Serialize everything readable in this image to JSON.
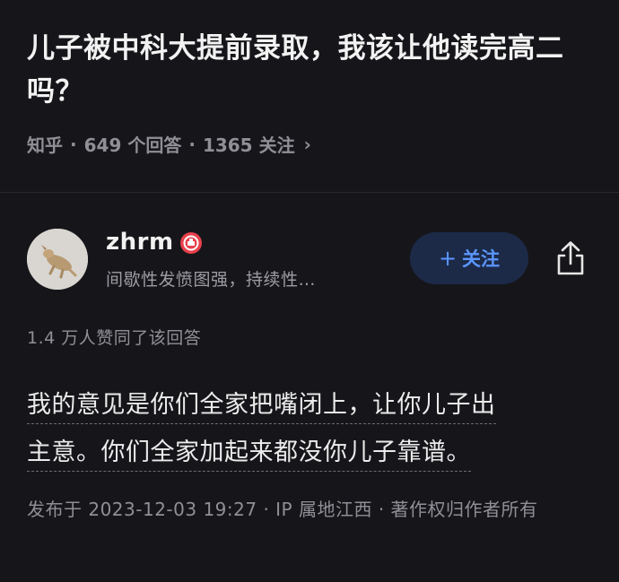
{
  "question": {
    "title": "儿子被中科大提前录取，我该让他读完高二吗？",
    "source": "知乎",
    "answer_count": "649 个回答",
    "follow_count": "1365 关注",
    "separator": "·",
    "chevron": "›"
  },
  "author": {
    "name": "zhrm",
    "bio": "间歇性发愤图强，持续性…",
    "follow_label": "关注",
    "follow_plus": "+"
  },
  "answer": {
    "vote_summary": "1.4 万人赞同了该回答",
    "content_lines": [
      "我的意见是你们全家把嘴闭上，让你儿子出",
      "主意。你们全家加起来都没你儿子靠谱。"
    ],
    "publish_info": "发布于 2023-12-03 19:27 · IP 属地江西 · 著作权归作者所有"
  },
  "colors": {
    "background": "#16161a",
    "follow_text": "#5b96ff",
    "follow_bg": "#1c2a48",
    "badge": "#e8414c"
  },
  "icons": {
    "badge": "badge-icon",
    "share": "share-icon",
    "chevron": "chevron-right-icon"
  }
}
